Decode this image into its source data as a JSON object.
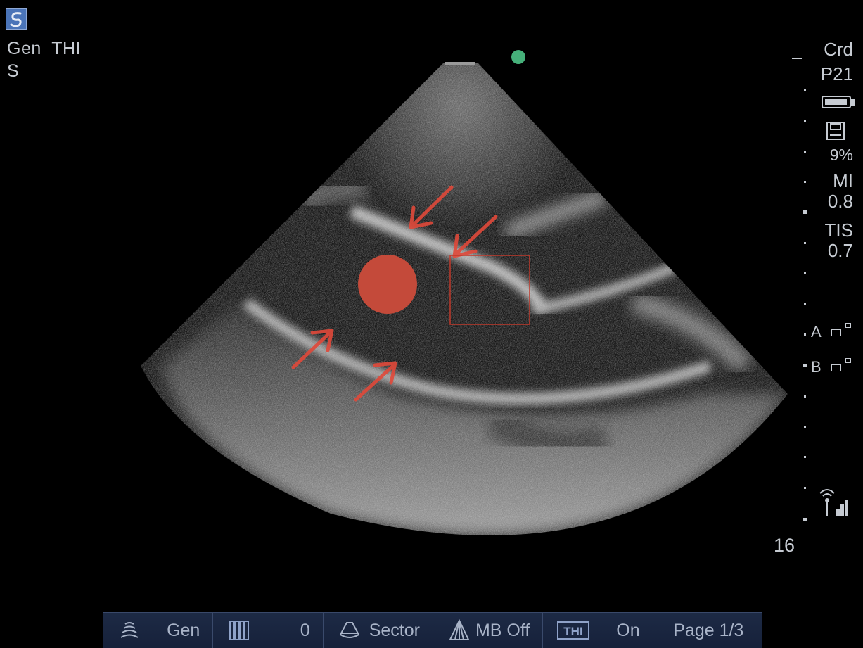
{
  "status_left": {
    "line1": "Gen  THI",
    "line2": "S"
  },
  "status_right": {
    "preset": "Crd",
    "probe": "P21",
    "storage_percent": "9%",
    "mi_label": "MI",
    "mi_value": "0.8",
    "tis_label": "TIS",
    "tis_value": "0.7",
    "focus_a": "A",
    "focus_b": "B"
  },
  "depth": "16",
  "toolbar": {
    "items": [
      {
        "icon": "gen-wave-icon",
        "value": "Gen"
      },
      {
        "icon": "gain-bars-icon",
        "value": "0"
      },
      {
        "icon": "sector-icon",
        "value": "Sector"
      },
      {
        "icon": "multibeam-icon",
        "value": "MB Off"
      },
      {
        "icon": "thi-icon",
        "label": "THI",
        "value": "On"
      },
      {
        "value": "Page 1/3"
      }
    ]
  },
  "colors": {
    "annotation_red": "#e0493a",
    "orientation_dot": "#46b07a",
    "toolbar_bg": "#1a2540",
    "overlay_text": "#c6cbd2"
  }
}
